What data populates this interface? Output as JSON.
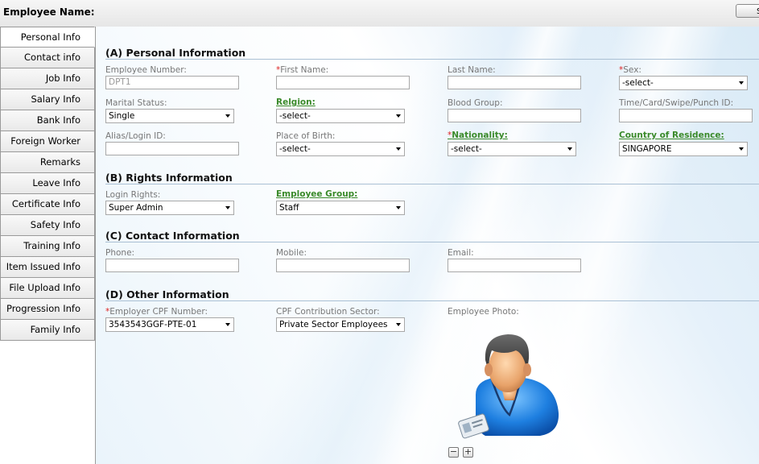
{
  "header": {
    "title": "Employee Name:",
    "button_label": "S"
  },
  "sidebar": {
    "items": [
      {
        "label": "Personal Info",
        "active": true
      },
      {
        "label": "Contact info"
      },
      {
        "label": "Job Info"
      },
      {
        "label": "Salary Info"
      },
      {
        "label": "Bank Info"
      },
      {
        "label": "Foreign Worker"
      },
      {
        "label": "Remarks"
      },
      {
        "label": "Leave Info"
      },
      {
        "label": "Certificate Info"
      },
      {
        "label": "Safety Info"
      },
      {
        "label": "Training Info"
      },
      {
        "label": "Item Issued Info"
      },
      {
        "label": "File Upload Info"
      },
      {
        "label": "Progression Info"
      },
      {
        "label": "Family Info"
      }
    ]
  },
  "sections": {
    "personal": {
      "title": "(A) Personal Information",
      "employee_number": {
        "label": "Employee Number:",
        "value": "DPT1"
      },
      "first_name": {
        "label": "First Name:",
        "value": ""
      },
      "last_name": {
        "label": "Last Name:",
        "value": ""
      },
      "sex": {
        "label": "Sex:",
        "value": "-select-"
      },
      "marital_status": {
        "label": "Marital Status:",
        "value": "Single"
      },
      "religion": {
        "label": "Relgion:",
        "value": "-select-"
      },
      "blood_group": {
        "label": "Blood Group:",
        "value": ""
      },
      "time_card": {
        "label": "Time/Card/Swipe/Punch ID:",
        "value": ""
      },
      "alias": {
        "label": "Alias/Login ID:",
        "value": ""
      },
      "place_of_birth": {
        "label": "Place of Birth:",
        "value": "-select-"
      },
      "nationality": {
        "label": "Nationality:",
        "value": "-select-"
      },
      "country": {
        "label": "Country of Residence:",
        "value": "SINGAPORE"
      }
    },
    "rights": {
      "title": "(B) Rights Information",
      "login_rights": {
        "label": "Login Rights:",
        "value": "Super Admin"
      },
      "employee_group": {
        "label": "Employee Group:",
        "value": "Staff"
      }
    },
    "contact": {
      "title": "(C) Contact Information",
      "phone": {
        "label": "Phone:",
        "value": ""
      },
      "mobile": {
        "label": "Mobile:",
        "value": ""
      },
      "email": {
        "label": "Email:",
        "value": ""
      }
    },
    "other": {
      "title": "(D) Other Information",
      "employer_cpf": {
        "label": "Employer CPF Number:",
        "value": "3543543GGF-PTE-01"
      },
      "cpf_sector": {
        "label": "CPF Contribution Sector:",
        "value": "Private Sector Employees"
      },
      "photo": {
        "label": "Employee Photo:",
        "zoom_out": "−",
        "zoom_in": "+"
      }
    }
  },
  "required_mark": "*",
  "colors": {
    "required": "#d22222",
    "link_label": "#3a8a2a",
    "section_line": "#aac0d4"
  }
}
